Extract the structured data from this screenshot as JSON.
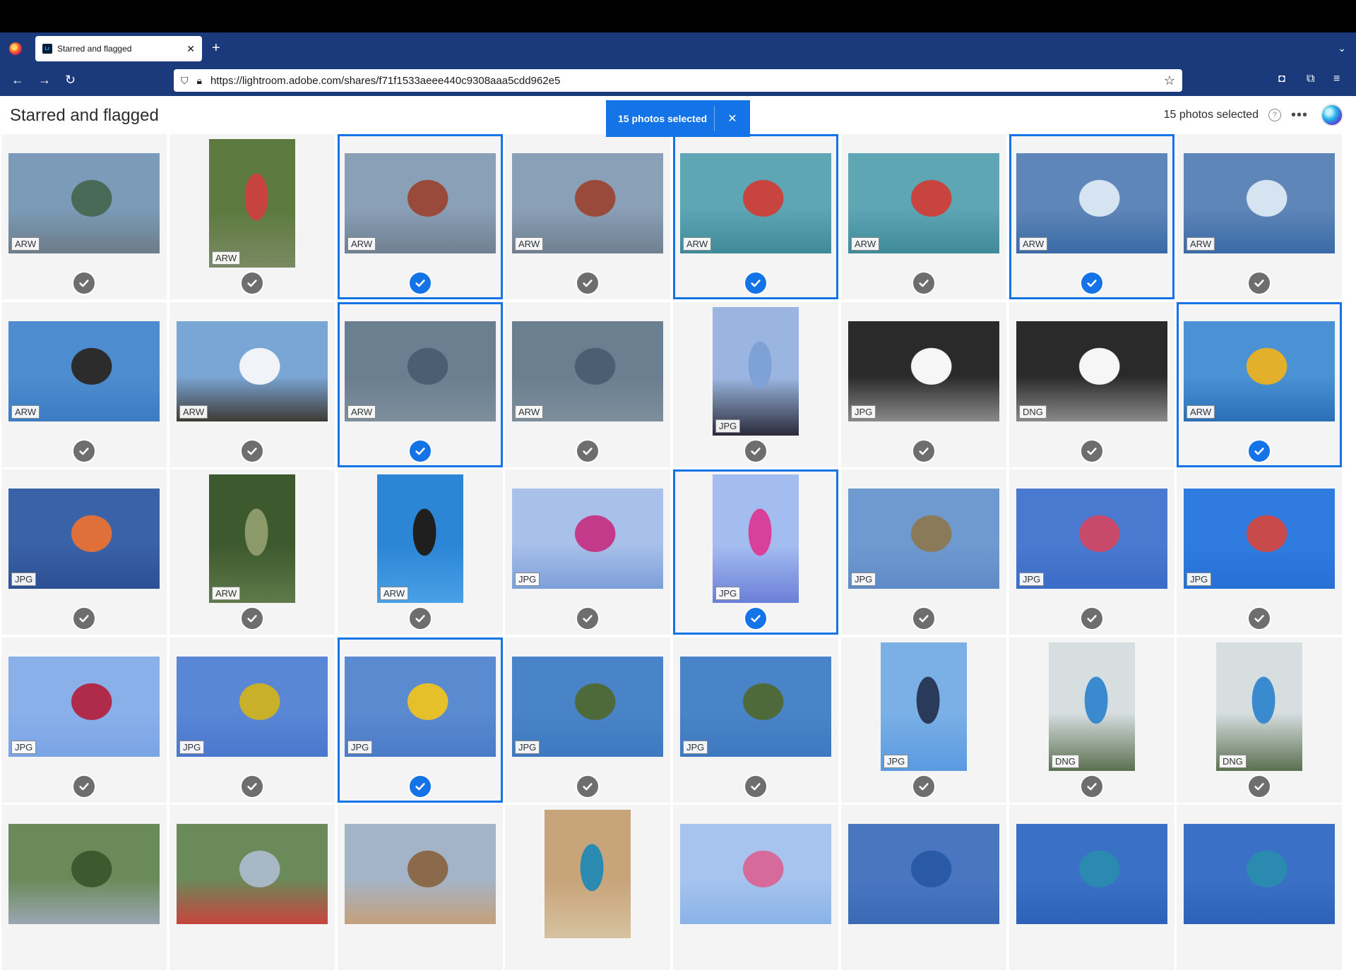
{
  "browser": {
    "tab_title": "Starred and flagged",
    "tab_favicon": "Lr",
    "url": "https://lightroom.adobe.com/shares/f71f1533aeee440c9308aaa5cdd962e5"
  },
  "header": {
    "title": "Starred and flagged",
    "selection_toast": "15 photos selected",
    "selected_count": "15 photos selected",
    "help": "?",
    "more": "•••"
  },
  "photos": [
    {
      "format": "ARW",
      "selected": false,
      "palette": [
        "#7b9bb8",
        "#4a6a58",
        "#6d7c88"
      ],
      "shape": "land"
    },
    {
      "format": "ARW",
      "selected": false,
      "palette": [
        "#5d7a3f",
        "#c7433f",
        "#7a8a63"
      ],
      "shape": "port"
    },
    {
      "format": "ARW",
      "selected": true,
      "palette": [
        "#8aa0b7",
        "#9a4a3a",
        "#6f8090"
      ],
      "shape": "land"
    },
    {
      "format": "ARW",
      "selected": false,
      "palette": [
        "#8aa0b7",
        "#9a4a3a",
        "#6f8090"
      ],
      "shape": "land"
    },
    {
      "format": "ARW",
      "selected": true,
      "palette": [
        "#5fa6b5",
        "#c8443e",
        "#3f8a98"
      ],
      "shape": "land"
    },
    {
      "format": "ARW",
      "selected": false,
      "palette": [
        "#5fa6b5",
        "#c8443e",
        "#3f8a98"
      ],
      "shape": "land"
    },
    {
      "format": "ARW",
      "selected": true,
      "palette": [
        "#5f86b8",
        "#d6e4f2",
        "#3a6aa6"
      ],
      "shape": "land"
    },
    {
      "format": "ARW",
      "selected": false,
      "palette": [
        "#5f86b8",
        "#d6e4f2",
        "#3a6aa6"
      ],
      "shape": "land"
    },
    {
      "format": "ARW",
      "selected": false,
      "palette": [
        "#4d8dcf",
        "#2c2c2c",
        "#3b7cc2"
      ],
      "shape": "land"
    },
    {
      "format": "ARW",
      "selected": false,
      "palette": [
        "#7aa6d6",
        "#f0f3f7",
        "#3e3a34"
      ],
      "shape": "land"
    },
    {
      "format": "ARW",
      "selected": true,
      "palette": [
        "#6a7f90",
        "#4c5f72",
        "#7d8e9c"
      ],
      "shape": "land"
    },
    {
      "format": "ARW",
      "selected": false,
      "palette": [
        "#6a7f90",
        "#4c5f72",
        "#7d8e9c"
      ],
      "shape": "land"
    },
    {
      "format": "JPG",
      "selected": false,
      "palette": [
        "#9ab6e0",
        "#7fa2d6",
        "#2a2a3a"
      ],
      "shape": "port"
    },
    {
      "format": "JPG",
      "selected": false,
      "palette": [
        "#2a2a2a",
        "#f6f6f6",
        "#8a8a8a"
      ],
      "shape": "land"
    },
    {
      "format": "DNG",
      "selected": false,
      "palette": [
        "#2a2a2a",
        "#f6f6f6",
        "#8a8a8a"
      ],
      "shape": "land"
    },
    {
      "format": "ARW",
      "selected": true,
      "palette": [
        "#4a92d4",
        "#e3b02c",
        "#2b6fb7"
      ],
      "shape": "land"
    },
    {
      "format": "JPG",
      "selected": false,
      "palette": [
        "#3a62a8",
        "#e0703a",
        "#2c5092"
      ],
      "shape": "land"
    },
    {
      "format": "ARW",
      "selected": false,
      "palette": [
        "#3d5a2e",
        "#8c9a6a",
        "#5f7a4a"
      ],
      "shape": "port"
    },
    {
      "format": "ARW",
      "selected": false,
      "palette": [
        "#2b86d6",
        "#1f1f1f",
        "#4aa0e6"
      ],
      "shape": "port"
    },
    {
      "format": "JPG",
      "selected": false,
      "palette": [
        "#a9c1ea",
        "#c43a8a",
        "#7d9fd9"
      ],
      "shape": "land"
    },
    {
      "format": "JPG",
      "selected": true,
      "palette": [
        "#a4bdf0",
        "#d8409a",
        "#6a7fd8"
      ],
      "shape": "port"
    },
    {
      "format": "JPG",
      "selected": false,
      "palette": [
        "#6f9ad0",
        "#8a7a5a",
        "#5f8ac6"
      ],
      "shape": "land"
    },
    {
      "format": "JPG",
      "selected": false,
      "palette": [
        "#4a7ad0",
        "#c84a6a",
        "#3b6cc6"
      ],
      "shape": "land"
    },
    {
      "format": "JPG",
      "selected": false,
      "palette": [
        "#2f7be0",
        "#c84a4a",
        "#2670d6"
      ],
      "shape": "land"
    },
    {
      "format": "JPG",
      "selected": false,
      "palette": [
        "#8ab0ea",
        "#b02a4a",
        "#7aa4e4"
      ],
      "shape": "land"
    },
    {
      "format": "JPG",
      "selected": false,
      "palette": [
        "#5a86d6",
        "#c8b02a",
        "#4a78cc"
      ],
      "shape": "land"
    },
    {
      "format": "JPG",
      "selected": true,
      "palette": [
        "#5a8ad0",
        "#e6c02a",
        "#4a7cc6"
      ],
      "shape": "land"
    },
    {
      "format": "JPG",
      "selected": false,
      "palette": [
        "#4a84c8",
        "#4f6a3a",
        "#3e78bf"
      ],
      "shape": "land"
    },
    {
      "format": "JPG",
      "selected": false,
      "palette": [
        "#4a84c8",
        "#4f6a3a",
        "#3e78bf"
      ],
      "shape": "land"
    },
    {
      "format": "JPG",
      "selected": false,
      "palette": [
        "#7ab0e6",
        "#2a3a5a",
        "#5a9ae0"
      ],
      "shape": "port"
    },
    {
      "format": "DNG",
      "selected": false,
      "palette": [
        "#d6dee0",
        "#3a8ad0",
        "#5a7050"
      ],
      "shape": "port"
    },
    {
      "format": "DNG",
      "selected": false,
      "palette": [
        "#d6dee0",
        "#3a8ad0",
        "#5a7050"
      ],
      "shape": "port"
    },
    {
      "format": "",
      "selected": false,
      "palette": [
        "#6a8a5a",
        "#3c5a2e",
        "#9aa6b0"
      ],
      "shape": "land"
    },
    {
      "format": "",
      "selected": false,
      "palette": [
        "#6a8a5a",
        "#a8b8c4",
        "#c8443e"
      ],
      "shape": "land"
    },
    {
      "format": "",
      "selected": false,
      "palette": [
        "#a4b4c8",
        "#8a6a4a",
        "#c4a07a"
      ],
      "shape": "land"
    },
    {
      "format": "",
      "selected": false,
      "palette": [
        "#c8a47a",
        "#2a8ab0",
        "#d6c2a0"
      ],
      "shape": "port"
    },
    {
      "format": "",
      "selected": false,
      "palette": [
        "#a6c4ee",
        "#d66a9a",
        "#8ab2e8"
      ],
      "shape": "land"
    },
    {
      "format": "",
      "selected": false,
      "palette": [
        "#4a76c0",
        "#2a5aa6",
        "#3a6ab4"
      ],
      "shape": "land"
    },
    {
      "format": "",
      "selected": false,
      "palette": [
        "#3a70c6",
        "#2a8ab0",
        "#2c62b8"
      ],
      "shape": "land"
    },
    {
      "format": "",
      "selected": false,
      "palette": [
        "#3a70c6",
        "#2a8ab0",
        "#2c62b8"
      ],
      "shape": "land"
    }
  ]
}
